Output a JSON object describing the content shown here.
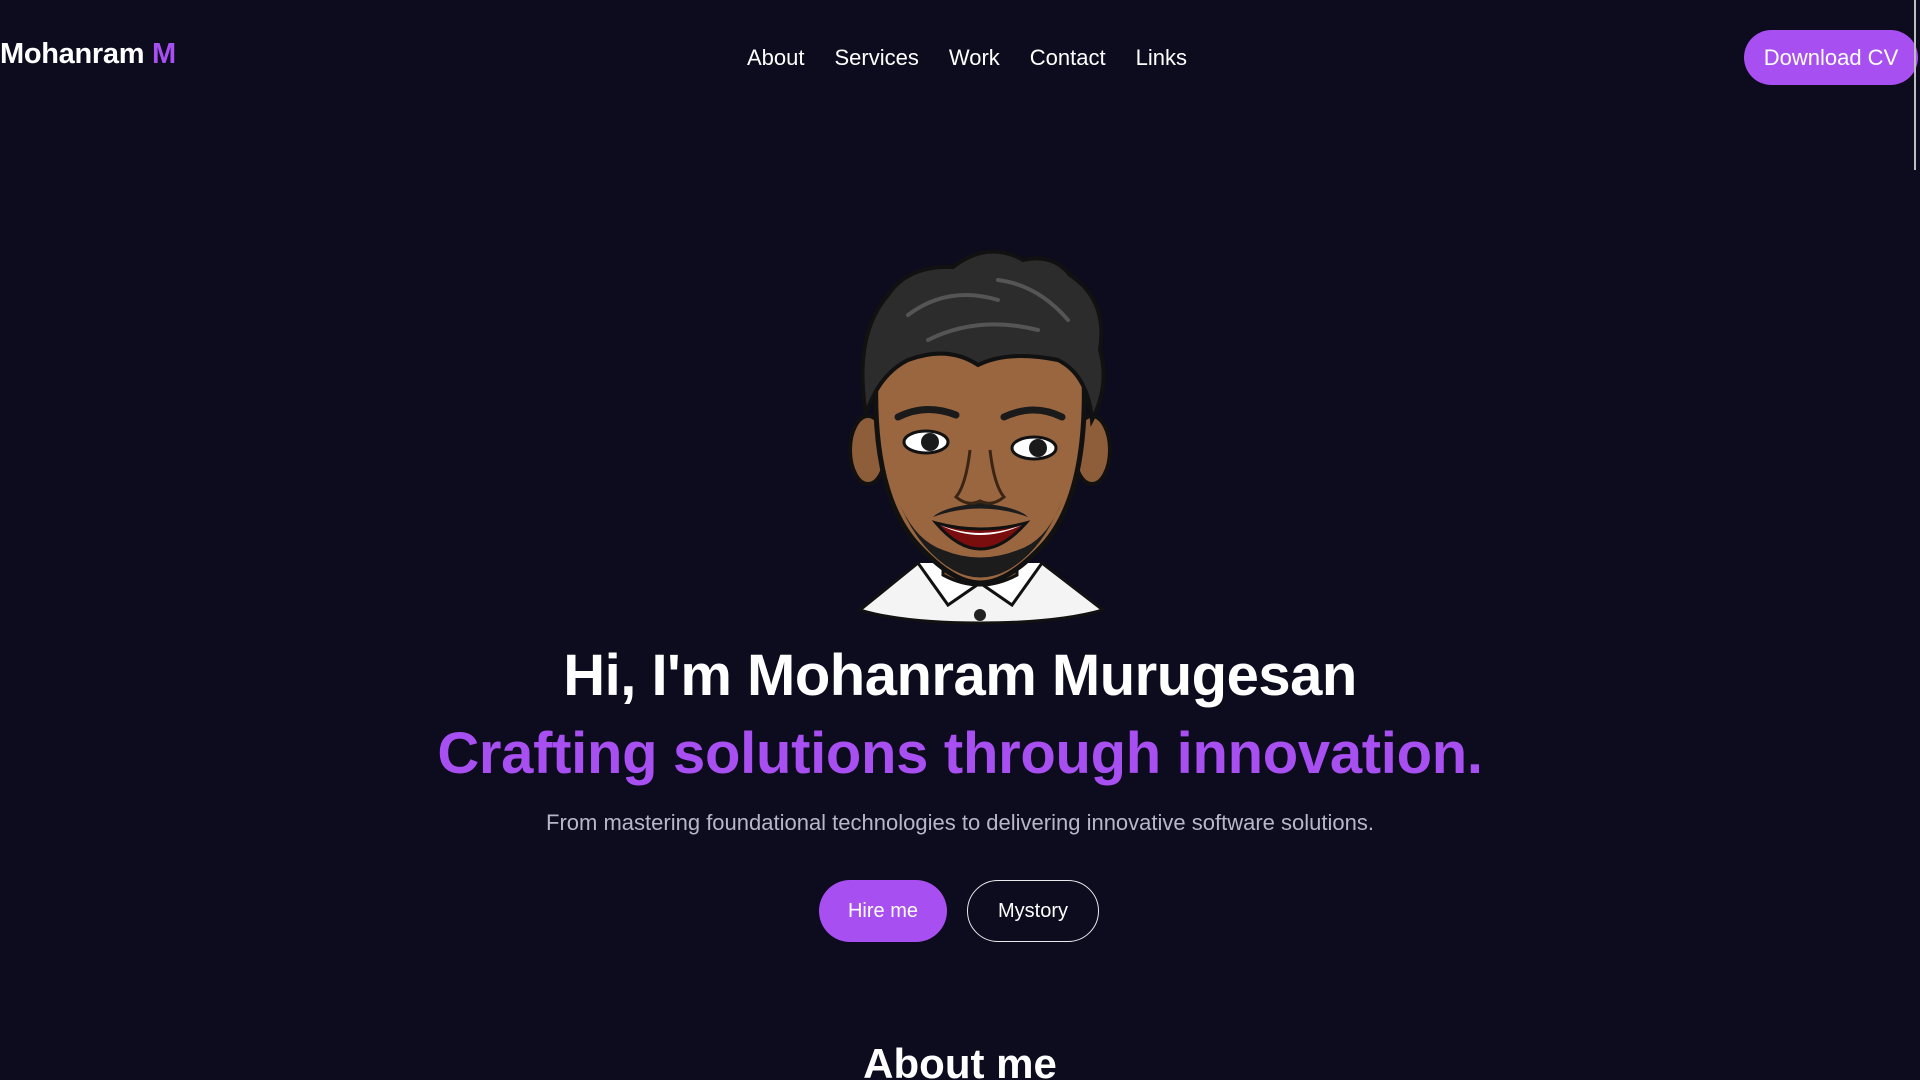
{
  "brand": {
    "name": "Mohanram",
    "initial": "M",
    "accent_color": "#a74ff0"
  },
  "nav": {
    "items": [
      {
        "label": "About"
      },
      {
        "label": "Services"
      },
      {
        "label": "Work"
      },
      {
        "label": "Contact"
      },
      {
        "label": "Links"
      }
    ],
    "cta_label": "Download CV"
  },
  "hero": {
    "avatar_icon": "memoji-avatar-icon",
    "title": "Hi, I'm Mohanram Murugesan",
    "subtitle": "Crafting solutions through innovation.",
    "description": "From mastering foundational technologies to delivering innovative software solutions.",
    "primary_button": "Hire me",
    "secondary_button": "Mystory"
  },
  "about": {
    "heading": "About me"
  },
  "colors": {
    "background": "#0d0b1e",
    "accent": "#a74ff0",
    "muted_text": "#b7b7c7"
  }
}
